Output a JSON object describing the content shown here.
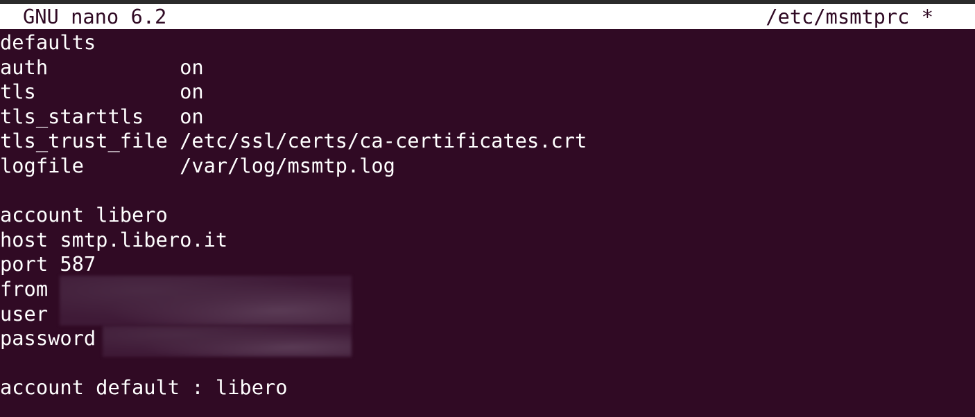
{
  "titlebar": {
    "app": "GNU nano 6.2",
    "filename": "/etc/msmtprc *"
  },
  "lines": [
    "defaults",
    "auth           on",
    "tls            on",
    "tls_starttls   on",
    "tls_trust_file /etc/ssl/certs/ca-certificates.crt",
    "logfile        /var/log/msmtp.log",
    "",
    "account libero",
    "host smtp.libero.it",
    "port 587",
    "from",
    "user",
    "password",
    "",
    "account default : libero"
  ],
  "colors": {
    "background": "#300a24",
    "titlebar": "#ffffff",
    "text": "#ffffff"
  }
}
